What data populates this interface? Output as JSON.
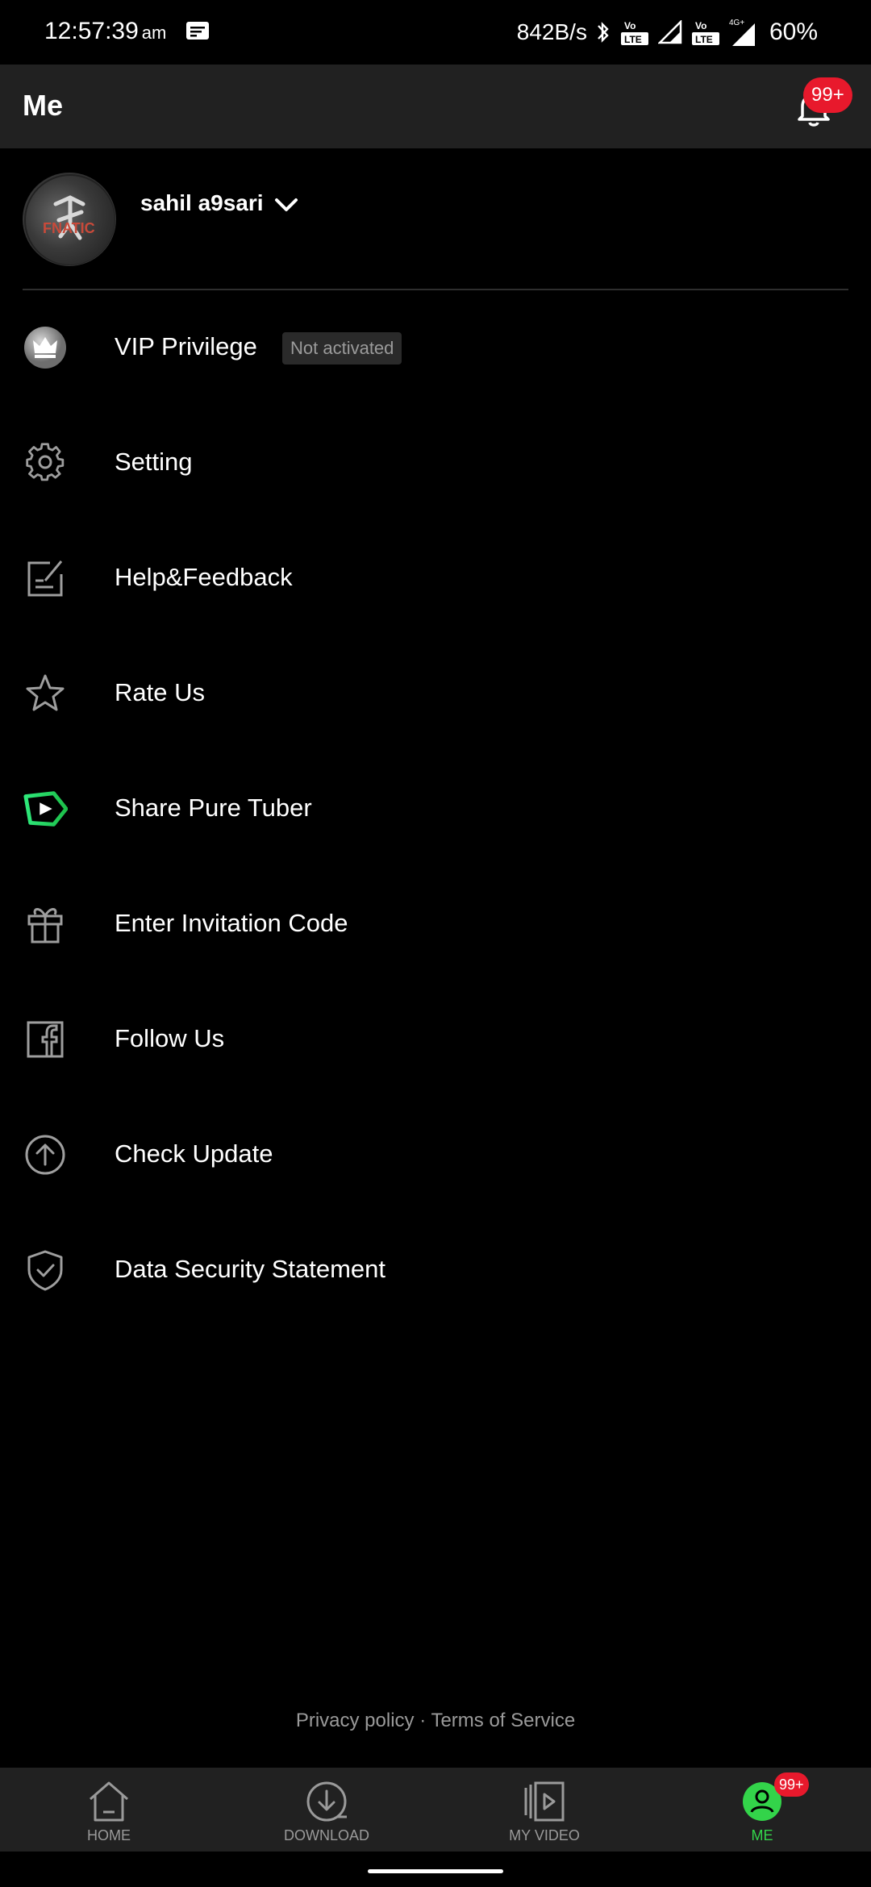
{
  "status_bar": {
    "time": "12:57:39",
    "ampm": "am",
    "net_speed": "842B/s",
    "network_1": "LTE",
    "network_2": "LTE",
    "network_tag": "4G+",
    "battery": "60%"
  },
  "app_bar": {
    "title": "Me",
    "notification_badge": "99+"
  },
  "profile": {
    "username": "sahil a9sari"
  },
  "menu": [
    {
      "label": "VIP Privilege",
      "icon": "crown-icon",
      "badge": "Not activated"
    },
    {
      "label": "Setting",
      "icon": "gear-icon"
    },
    {
      "label": "Help&Feedback",
      "icon": "feedback-icon"
    },
    {
      "label": "Rate Us",
      "icon": "star-icon"
    },
    {
      "label": "Share Pure Tuber",
      "icon": "share-play-icon"
    },
    {
      "label": "Enter Invitation Code",
      "icon": "gift-icon"
    },
    {
      "label": "Follow Us",
      "icon": "facebook-icon"
    },
    {
      "label": "Check Update",
      "icon": "arrow-up-circle-icon"
    },
    {
      "label": "Data Security Statement",
      "icon": "shield-check-icon"
    }
  ],
  "footer": {
    "privacy": "Privacy policy",
    "separator": " · ",
    "terms": "Terms of Service"
  },
  "bottom_nav": {
    "items": [
      {
        "label": "HOME",
        "icon": "home-icon"
      },
      {
        "label": "DOWNLOAD",
        "icon": "download-icon"
      },
      {
        "label": "MY VIDEO",
        "icon": "video-library-icon"
      },
      {
        "label": "ME",
        "icon": "person-icon"
      }
    ],
    "active": "ME",
    "me_badge": "99+"
  },
  "colors": {
    "accent": "#33d44a",
    "badge": "#e8192c",
    "bar_bg": "#212121",
    "background": "#000000"
  }
}
